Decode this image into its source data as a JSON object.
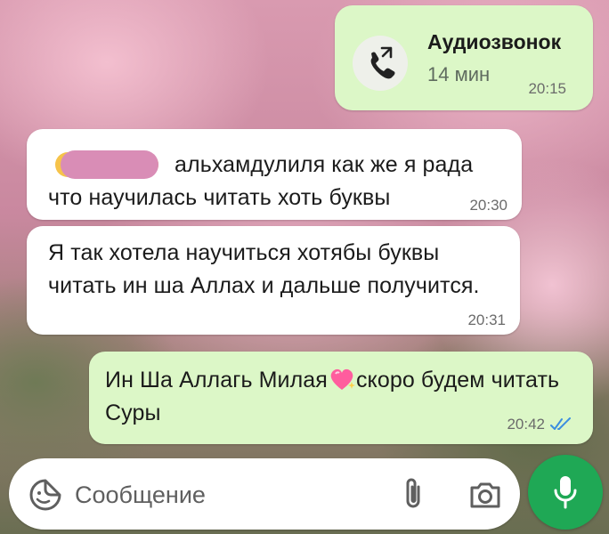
{
  "call": {
    "title": "Аудиозвонок",
    "duration": "14 мин",
    "time": "20:15",
    "icon": "outgoing-call-icon"
  },
  "messages": [
    {
      "direction": "incoming",
      "text": "альхамдулиля как же я рада что научилась читать хоть буквы",
      "time": "20:30"
    },
    {
      "direction": "incoming",
      "text": "Я так хотела научиться хотябы буквы читать ин ша Аллах и дальше получится.",
      "time": "20:31"
    },
    {
      "direction": "outgoing",
      "text_before_emoji": "Ин Ша Аллагь Милая",
      "emoji": "sparkling-heart",
      "text_after_emoji": "скоро будем читать Суры",
      "time": "20:42",
      "status": "read"
    }
  ],
  "composer": {
    "placeholder": "Сообщение",
    "icons": [
      "sticker-icon",
      "attach-icon",
      "camera-icon",
      "mic-icon"
    ]
  },
  "colors": {
    "incoming_bubble": "#ffffff",
    "outgoing_bubble": "#dcf7c7",
    "mic_button": "#1fa855",
    "read_ticks": "#3b8ee0"
  }
}
